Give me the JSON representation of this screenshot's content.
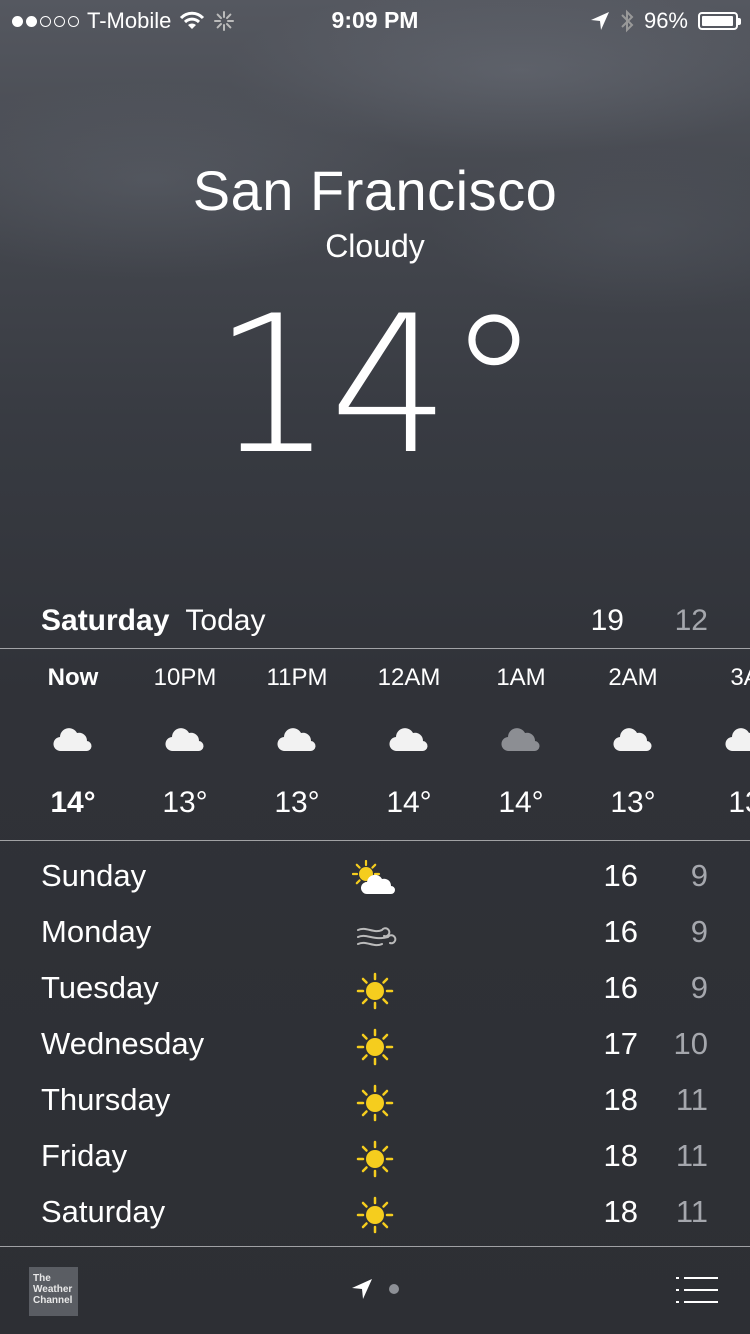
{
  "status_bar": {
    "carrier": "T-Mobile",
    "time": "9:09 PM",
    "battery": "96%",
    "battery_level": 0.96,
    "signal_bars": 2,
    "icons": [
      "wifi-icon",
      "activity-spinner-icon",
      "location-arrow-icon",
      "bluetooth-icon",
      "battery-icon"
    ]
  },
  "location": {
    "city": "San Francisco",
    "condition": "Cloudy",
    "temperature": "14°"
  },
  "today": {
    "day": "Saturday",
    "label": "Today",
    "high": "19",
    "low": "12"
  },
  "hourly": [
    {
      "time": "Now",
      "icon": "cloud-icon",
      "temp": "14°"
    },
    {
      "time": "10PM",
      "icon": "cloud-icon",
      "temp": "13°"
    },
    {
      "time": "11PM",
      "icon": "cloud-icon",
      "temp": "13°"
    },
    {
      "time": "12AM",
      "icon": "cloud-icon",
      "temp": "14°"
    },
    {
      "time": "1AM",
      "icon": "dark-cloud-icon",
      "temp": "14°"
    },
    {
      "time": "2AM",
      "icon": "cloud-icon",
      "temp": "13°"
    },
    {
      "time": "3A",
      "icon": "cloud-icon",
      "temp": "13"
    }
  ],
  "daily": [
    {
      "day": "Sunday",
      "icon": "partly-cloudy-icon",
      "high": "16",
      "low": "9"
    },
    {
      "day": "Monday",
      "icon": "wind-icon",
      "high": "16",
      "low": "9"
    },
    {
      "day": "Tuesday",
      "icon": "sun-icon",
      "high": "16",
      "low": "9"
    },
    {
      "day": "Wednesday",
      "icon": "sun-icon",
      "high": "17",
      "low": "10"
    },
    {
      "day": "Thursday",
      "icon": "sun-icon",
      "high": "18",
      "low": "11"
    },
    {
      "day": "Friday",
      "icon": "sun-icon",
      "high": "18",
      "low": "11"
    },
    {
      "day": "Saturday",
      "icon": "sun-icon",
      "high": "18",
      "low": "11"
    }
  ],
  "footer": {
    "logo_text": "The Weather Channel",
    "icons": [
      "weather-channel-logo",
      "current-location-icon",
      "page-indicator-dot",
      "list-icon"
    ]
  },
  "colors": {
    "sun": "#f5cd1e",
    "secondary_text": "#a5a7ad",
    "background": "#303238"
  }
}
